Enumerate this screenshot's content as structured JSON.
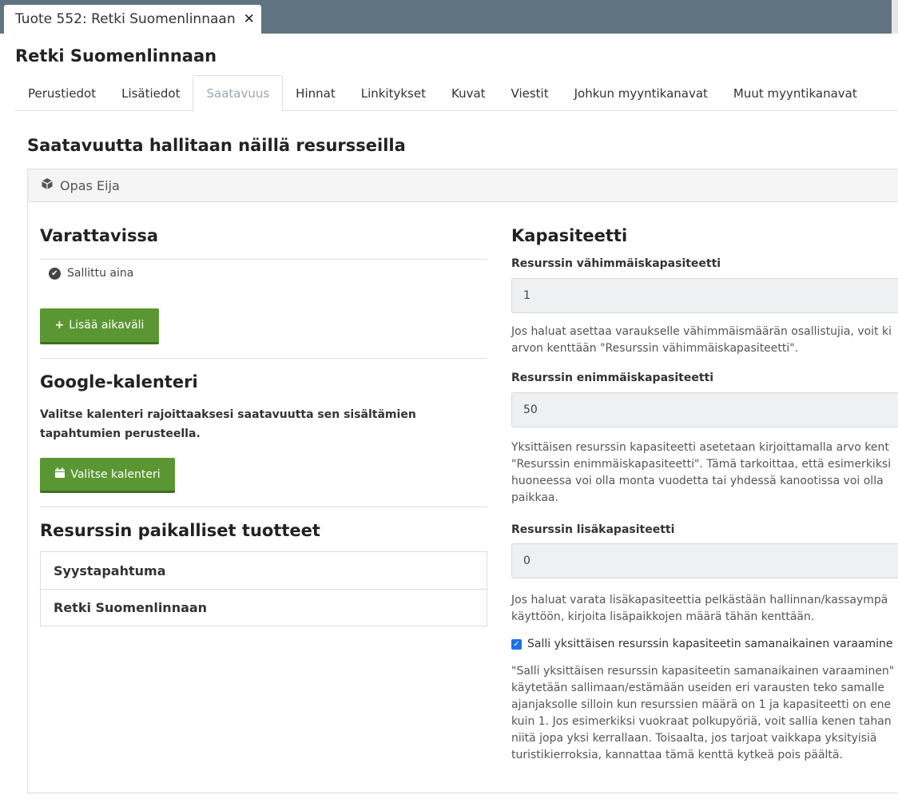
{
  "window": {
    "tab_title": "Tuote 552: Retki Suomenlinnaan",
    "close_icon": "✕"
  },
  "product_title": "Retki Suomenlinnaan",
  "tabs": [
    {
      "label": "Perustiedot"
    },
    {
      "label": "Lisätiedot"
    },
    {
      "label": "Saatavuus",
      "active": true
    },
    {
      "label": "Hinnat"
    },
    {
      "label": "Linkitykset"
    },
    {
      "label": "Kuvat"
    },
    {
      "label": "Viestit"
    },
    {
      "label": "Johkun myyntikanavat"
    },
    {
      "label": "Muut myyntikanavat"
    }
  ],
  "section_heading": "Saatavuutta hallitaan näillä resursseilla",
  "resource": {
    "icon": "cube-icon",
    "name": "Opas Eija"
  },
  "availability": {
    "heading": "Varattavissa",
    "status": "Sallittu aina",
    "add_button": "Lisää aikaväli"
  },
  "google_calendar": {
    "heading": "Google-kalenteri",
    "description": "Valitse kalenteri rajoittaaksesi saatavuutta sen sisältämien tapahtumien perusteella.",
    "select_button": "Valitse kalenteri"
  },
  "local_products": {
    "heading": "Resurssin paikalliset tuotteet",
    "items": [
      "Syystapahtuma",
      "Retki Suomenlinnaan"
    ]
  },
  "capacity": {
    "heading": "Kapasiteetti",
    "min_label": "Resurssin vähimmäiskapasiteetti",
    "min_value": "1",
    "min_help": "Jos haluat asettaa varaukselle vähimmäismäärän osallistujia, voit ki\narvon kenttään \"Resurssin vähimmäiskapasiteetti\".",
    "max_label": "Resurssin enimmäiskapasiteetti",
    "max_value": "50",
    "max_help": "Yksittäisen resurssin kapasiteetti asetetaan kirjoittamalla arvo kent\n\"Resurssin enimmäiskapasiteetti\". Tämä tarkoittaa, että esimerkiksi\nhuoneessa voi olla monta vuodetta tai yhdessä kanootissa voi olla\npaikkaa.",
    "extra_label": "Resurssin lisäkapasiteetti",
    "extra_value": "0",
    "extra_help": "Jos haluat varata lisäkapasiteettia pelkästään hallinnan/kassaympä\nkäyttöön, kirjoita lisäpaikkojen määrä tähän kenttään.",
    "concurrent_checkbox_label": "Salli yksittäisen resurssin kapasiteetin samanaikainen varaamine",
    "concurrent_checked": true,
    "concurrent_help": "\"Salli yksittäisen resurssin kapasiteetin samanaikainen varaaminen\"\nkäytetään sallimaan/estämään useiden eri varausten teko samalle\najanjaksolle silloin kun resurssien määrä on 1 ja kapasiteetti on ene\nkuin 1. Jos esimerkiksi vuokraat polkupyöriä, voit sallia kenen tahan\nniitä jopa yksi kerrallaan. Toisaalta, jos tarjoat vaikkapa yksityisiä\nturistikierroksia, kannattaa tämä kenttä kytkeä pois päältä."
  },
  "colors": {
    "topbar": "#5f7480",
    "button_green": "#5a9733",
    "active_tab_text": "#9aa6b0",
    "input_bg": "#eef0f2"
  }
}
